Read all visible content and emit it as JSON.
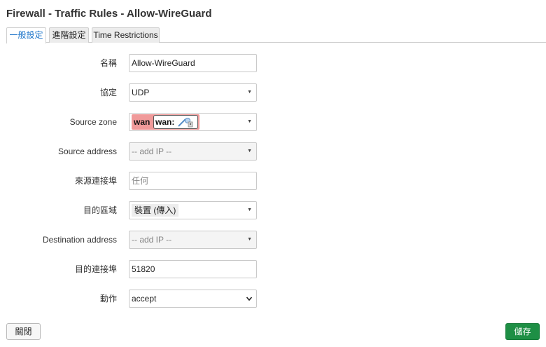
{
  "page": {
    "title": "Firewall - Traffic Rules - Allow-WireGuard"
  },
  "tabs": [
    {
      "label": "一般設定",
      "active": true
    },
    {
      "label": "進階設定",
      "active": false
    },
    {
      "label": "Time Restrictions",
      "active": false
    }
  ],
  "form": {
    "name": {
      "label": "名稱",
      "value": "Allow-WireGuard"
    },
    "protocol": {
      "label": "協定",
      "value": "UDP"
    },
    "source_zone": {
      "label": "Source zone",
      "zone": "wan",
      "chip": "wan:",
      "color": "#f09a9a"
    },
    "source_address": {
      "label": "Source address",
      "placeholder": "-- add IP --"
    },
    "source_port": {
      "label": "來源連接埠",
      "placeholder": "任何"
    },
    "destination_zone": {
      "label": "目的區域",
      "value": "裝置 (傳入)"
    },
    "destination_address": {
      "label": "Destination address",
      "placeholder": "-- add IP --"
    },
    "destination_port": {
      "label": "目的連接埠",
      "value": "51820"
    },
    "action": {
      "label": "動作",
      "value": "accept"
    }
  },
  "buttons": {
    "close": "關閉",
    "save": "儲存",
    "save_color": "#1e8f45"
  },
  "icons": {
    "select_caret": "▼",
    "zone_icon": "network-ethernet-icon"
  }
}
